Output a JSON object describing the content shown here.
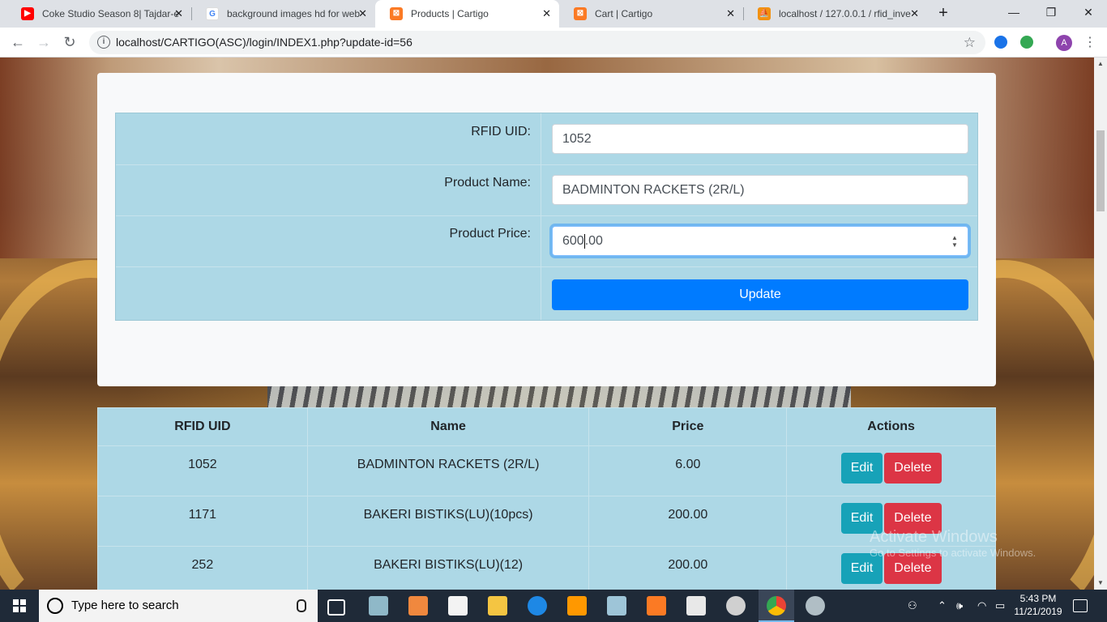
{
  "browser": {
    "tabs": [
      {
        "title": "Coke Studio Season 8| Tajdar-e",
        "favicon": "youtube-icon",
        "favicon_color": "#ff0000",
        "favicon_glyph": "▶",
        "active": false
      },
      {
        "title": "background images hd for web",
        "favicon": "google-icon",
        "favicon_color": "#4285f4",
        "favicon_glyph": "G",
        "active": false
      },
      {
        "title": "Products | Cartigo",
        "favicon": "xampp-icon",
        "favicon_color": "#fb7a24",
        "favicon_glyph": "⊠",
        "active": true
      },
      {
        "title": "Cart | Cartigo",
        "favicon": "xampp-icon",
        "favicon_color": "#fb7a24",
        "favicon_glyph": "⊠",
        "active": false
      },
      {
        "title": "localhost / 127.0.0.1 / rfid_inve",
        "favicon": "phpmyadmin-icon",
        "favicon_color": "#f29111",
        "favicon_glyph": "⛵",
        "active": false
      }
    ],
    "url": "localhost/CARTIGO(ASC)/login/INDEX1.php?update-id=56",
    "profile_initial": "A"
  },
  "form": {
    "rfid_label": "RFID UID:",
    "rfid_value": "1052",
    "name_label": "Product Name:",
    "name_value": "BADMINTON RACKETS (2R/L)",
    "price_label": "Product Price:",
    "price_value_before_caret": "600",
    "price_value_after_caret": ".00",
    "update_label": "Update"
  },
  "table": {
    "headers": [
      "RFID UID",
      "Name",
      "Price",
      "Actions"
    ],
    "rows": [
      {
        "uid": "1052",
        "name": "BADMINTON RACKETS (2R/L)",
        "price": "6.00",
        "edit": "Edit",
        "delete": "Delete"
      },
      {
        "uid": "1171",
        "name": "BAKERI BISTIKS(LU)(10pcs)",
        "price": "200.00",
        "edit": "Edit",
        "delete": "Delete"
      },
      {
        "uid": "252",
        "name": "BAKERI BISTIKS(LU)(12)",
        "price": "200.00",
        "edit": "Edit",
        "delete": "Delete"
      }
    ]
  },
  "watermark": {
    "line1": "Activate Windows",
    "line2": "Go to Settings to activate Windows."
  },
  "taskbar": {
    "search_placeholder": "Type here to search",
    "time": "5:43 PM",
    "date": "11/21/2019",
    "pinned_icons": [
      "task-view-icon",
      "app-icon",
      "visual-studio-icon",
      "store-icon",
      "file-explorer-icon",
      "edge-icon",
      "sublime-text-icon",
      "notepad-icon",
      "xampp-icon",
      "photos-icon",
      "settings-icon",
      "chrome-icon",
      "paint-icon"
    ]
  },
  "colors": {
    "primary": "#007bff",
    "info": "#17a2b8",
    "danger": "#dc3545",
    "table_bg": "#add8e6"
  }
}
